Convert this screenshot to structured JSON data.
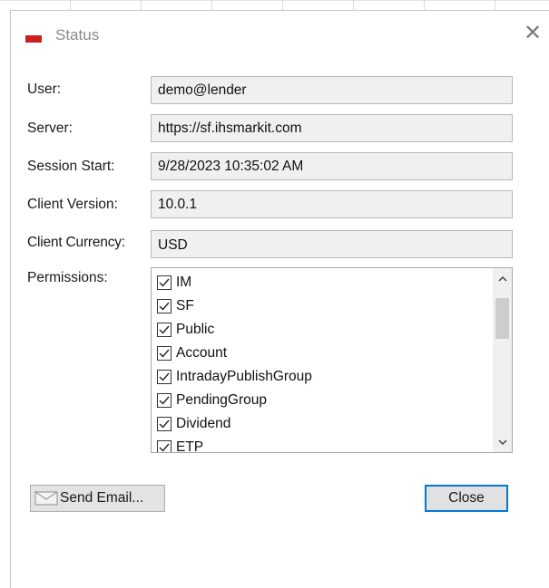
{
  "window": {
    "title": "Status",
    "close_glyph": "✕"
  },
  "fields": [
    {
      "label": "User:",
      "value": "demo@lender"
    },
    {
      "label": "Server:",
      "value": "https://sf.ihsmarkit.com"
    },
    {
      "label": "Session Start:",
      "value": "9/28/2023 10:35:02 AM"
    },
    {
      "label": "Client Version:",
      "value": "10.0.1"
    },
    {
      "label": "Client Currency:",
      "value": "USD"
    }
  ],
  "permissions": {
    "label": "Permissions:",
    "items": [
      {
        "name": "IM",
        "checked": true
      },
      {
        "name": "SF",
        "checked": true
      },
      {
        "name": "Public",
        "checked": true
      },
      {
        "name": "Account",
        "checked": true
      },
      {
        "name": "IntradayPublishGroup",
        "checked": true
      },
      {
        "name": "PendingGroup",
        "checked": true
      },
      {
        "name": "Dividend",
        "checked": true
      },
      {
        "name": "ETP",
        "checked": true
      }
    ]
  },
  "buttons": {
    "send_email": "Send Email...",
    "close": "Close"
  },
  "colors": {
    "focus_border": "#0078d7",
    "app_icon_red": "#cc1e1e"
  },
  "icons": {
    "app": "app-logo-icon",
    "close": "close-icon",
    "email": "envelope-icon",
    "scroll_up": "chevron-up-icon",
    "scroll_down": "chevron-down-icon",
    "check": "checkmark-icon"
  }
}
